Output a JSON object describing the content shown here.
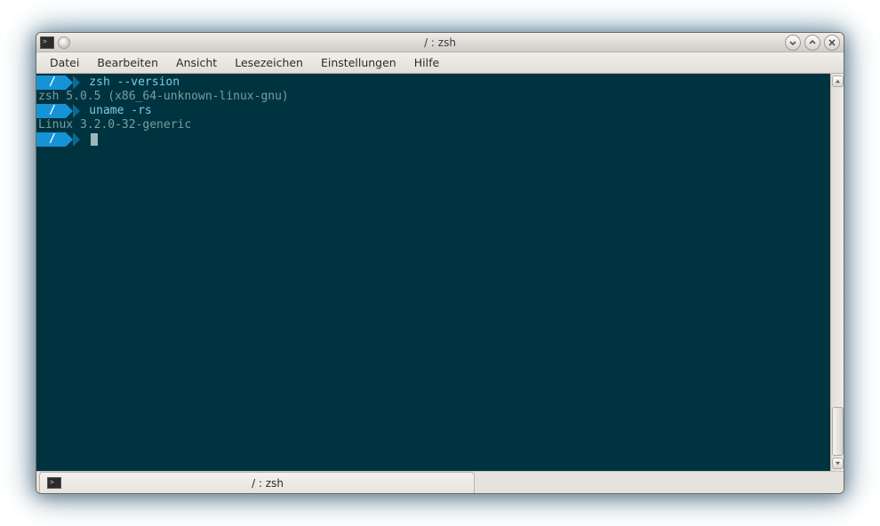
{
  "window": {
    "title": "/ : zsh"
  },
  "menubar": {
    "items": [
      "Datei",
      "Bearbeiten",
      "Ansicht",
      "Lesezeichen",
      "Einstellungen",
      "Hilfe"
    ]
  },
  "terminal": {
    "prompt_dir": "/",
    "lines": [
      {
        "type": "prompt",
        "cmd": "zsh --version"
      },
      {
        "type": "output",
        "text": "zsh 5.0.5 (x86_64-unknown-linux-gnu)"
      },
      {
        "type": "prompt",
        "cmd": "uname -rs"
      },
      {
        "type": "output",
        "text": "Linux 3.2.0-32-generic"
      },
      {
        "type": "prompt",
        "cmd": "",
        "cursor": true
      }
    ]
  },
  "tab": {
    "label": "/ : zsh"
  },
  "colors": {
    "term_bg": "#003340",
    "term_fg": "#c7d6d8",
    "prompt_bg": "#1693d6",
    "prompt_arrow_dim": "#0a6a94",
    "cmd_color": "#7ecbe6",
    "output_color": "#7a9ea3"
  }
}
